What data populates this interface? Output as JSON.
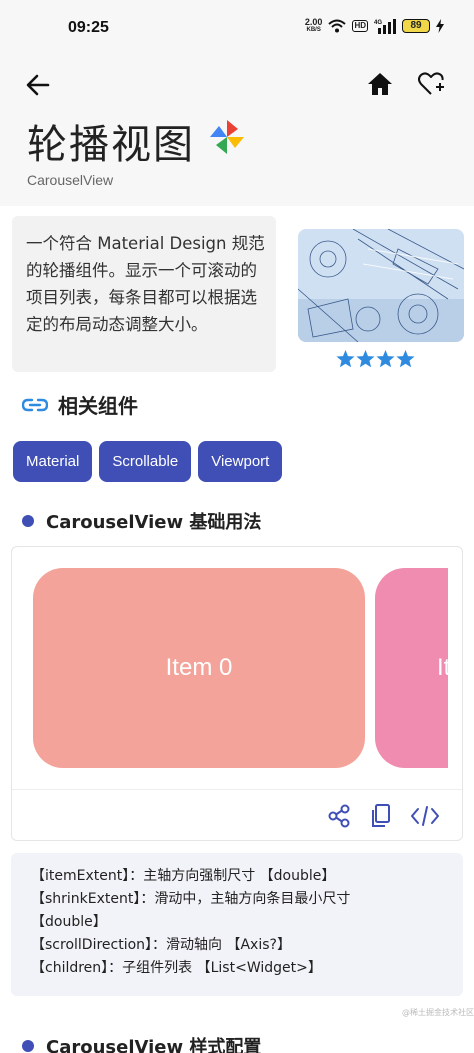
{
  "status_bar": {
    "time": "09:25",
    "net_speed": "2.00",
    "net_unit": "KB/S",
    "hd": "HD",
    "signal": "4G",
    "battery": "89"
  },
  "header": {
    "title": "轮播视图",
    "subtitle": "CarouselView"
  },
  "description": "一个符合 Material Design 规范的轮播组件。显示一个可滚动的项目列表，每条目都可以根据选定的布局动态调整大小。",
  "rating": {
    "value": 4,
    "max": 4
  },
  "related": {
    "label": "相关组件",
    "chips": [
      "Material",
      "Scrollable",
      "Viewport"
    ]
  },
  "section_basic": {
    "title": "CarouselView 基础用法",
    "items": [
      "Item 0",
      "It"
    ]
  },
  "properties": [
    "【itemExtent】：主轴方向强制尺寸  【double】",
    "【shrinkExtent】：滑动中，主轴方向条目最小尺寸",
    "【double】",
    "【scrollDirection】：滑动轴向  【Axis?】",
    "【children】：子组件列表  【List<Widget>】"
  ],
  "watermark": "@稀土掘金技术社区",
  "section_style": {
    "title": "CarouselView 样式配置"
  },
  "colors": {
    "accent": "#3f4fb5",
    "item0": "#f3a39a",
    "item1": "#f08caf",
    "star": "#2f8be0"
  }
}
